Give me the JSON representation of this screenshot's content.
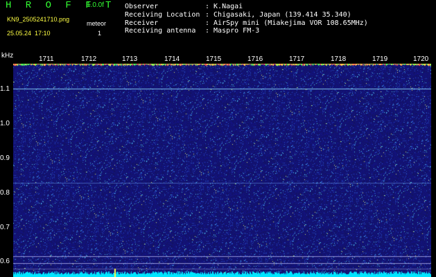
{
  "header": {
    "app_name": "H R O F F T",
    "version": "1.0.0f",
    "filename": "KN9_2505241710.png",
    "meteor_label": "meteor",
    "meteor_count": "1",
    "datetime": "25.05.24  17:10"
  },
  "info": [
    {
      "label": "Observer",
      "value": ": K.Nagai"
    },
    {
      "label": "Receiving Location",
      "value": ": Chigasaki, Japan (139.414 35.340)"
    },
    {
      "label": "Receiver",
      "value": ": AirSpy mini (Miakejima VOR 108.65MHz)"
    },
    {
      "label": "Receiving antenna",
      "value": ": Maspro FM-3"
    }
  ],
  "axes": {
    "y_unit": "kHz",
    "x_ticks": [
      "1711",
      "1712",
      "1713",
      "1714",
      "1715",
      "1716",
      "1717",
      "1718",
      "1719",
      "1720"
    ],
    "y_ticks": [
      "1.1",
      "1.0",
      "0.9",
      "0.8",
      "0.7",
      "0.6"
    ]
  },
  "colors": {
    "background": "#000000",
    "waterfall_base": "#1a1a66",
    "accent": "#33ff33",
    "yellow": "#ffff44",
    "signal": "#00e5ff"
  }
}
